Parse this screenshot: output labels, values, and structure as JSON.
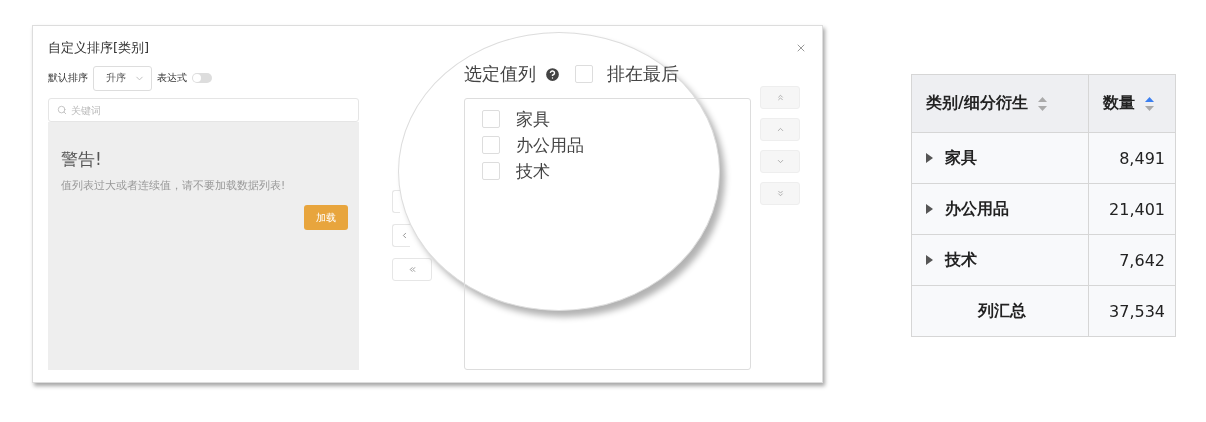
{
  "dialog": {
    "title": "自定义排序[类别]",
    "sort": {
      "label": "默认排序",
      "value": "升序"
    },
    "expression": {
      "label": "表达式",
      "on": false
    },
    "search": {
      "placeholder": "关键词"
    },
    "warning": {
      "title": "警告!",
      "message": "值列表过大或者连续值，请不要加载数据列表!",
      "button": "加载"
    },
    "selected_list": {
      "title": "选定值列",
      "place_last": {
        "label": "排在最后",
        "checked": false
      },
      "items": [
        {
          "label": "家具",
          "checked": false
        },
        {
          "label": "办公用品",
          "checked": false
        },
        {
          "label": "技术",
          "checked": false
        }
      ]
    }
  },
  "table": {
    "columns": [
      {
        "label": "类别/细分衍生",
        "sorted": false
      },
      {
        "label": "数量",
        "sorted": true
      }
    ],
    "rows": [
      {
        "kind": "group",
        "label": "家具",
        "value": "8,491"
      },
      {
        "kind": "group",
        "label": "办公用品",
        "value": "21,401"
      },
      {
        "kind": "group",
        "label": "技术",
        "value": "7,642"
      },
      {
        "kind": "total",
        "label": "列汇总",
        "value": "37,534"
      }
    ]
  }
}
